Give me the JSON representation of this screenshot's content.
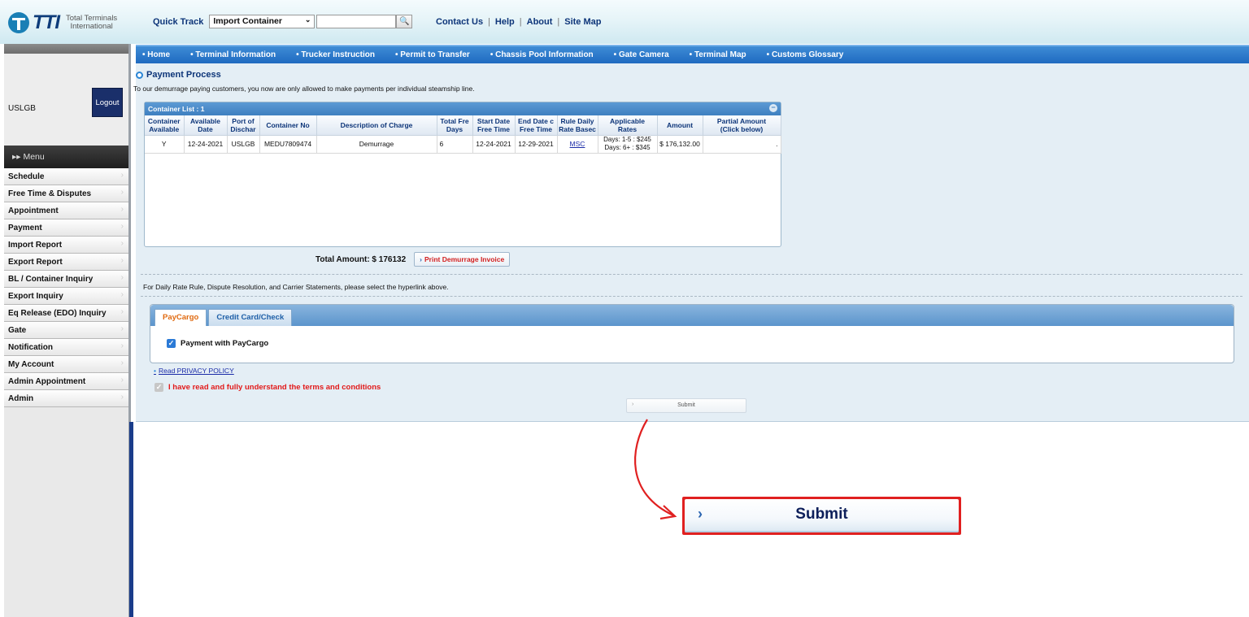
{
  "header": {
    "logo_text": "TTI",
    "logo_sub_line1": "Total Terminals",
    "logo_sub_line2": "International",
    "quick_track_label": "Quick Track",
    "quick_track_select": "Import Container",
    "quick_track_input": "",
    "top_links": [
      "Contact Us",
      "Help",
      "About",
      "Site Map"
    ]
  },
  "sidebar": {
    "user": "USLGB",
    "logout_label": "Logout",
    "menu_label": "▸▸ Menu",
    "items": [
      "Schedule",
      "Free Time & Disputes",
      "Appointment",
      "Payment",
      "Import Report",
      "Export Report",
      "BL / Container Inquiry",
      "Export Inquiry",
      "Eq Release (EDO) Inquiry",
      "Gate",
      "Notification",
      "My Account",
      "Admin Appointment",
      "Admin"
    ]
  },
  "nav": [
    "Home",
    "Terminal Information",
    "Trucker Instruction",
    "Permit to Transfer",
    "Chassis Pool Information",
    "Gate Camera",
    "Terminal Map",
    "Customs Glossary"
  ],
  "main": {
    "title": "Payment Process",
    "note": "To our demurrage paying customers, you now are only allowed to make payments per individual steamship line.",
    "container_list": {
      "header": "Container List : 1",
      "columns": [
        [
          "Container",
          "Available"
        ],
        [
          "Available",
          "Date"
        ],
        [
          "Port of",
          "Dischar"
        ],
        [
          "Container No",
          ""
        ],
        [
          "Description of Charge",
          ""
        ],
        [
          "Total Fre",
          "Days"
        ],
        [
          "Start Date",
          "Free Time"
        ],
        [
          "End Date c",
          "Free Time"
        ],
        [
          "Rule Daily",
          "Rate Basec"
        ],
        [
          "Applicable",
          "Rates"
        ],
        [
          "Amount",
          ""
        ],
        [
          "Partial Amount",
          "(Click below)"
        ]
      ],
      "row": {
        "available": "Y",
        "available_date": "12-24-2021",
        "port": "USLGB",
        "container_no": "MEDU7809474",
        "description": "Demurrage",
        "free_days": "6",
        "start_date": "12-24-2021",
        "end_date": "12-29-2021",
        "rule": "MSC",
        "rates_line1": "Days: 1-5 : $245",
        "rates_line2": "Days: 6+ : $345",
        "amount": "$ 176,132.00",
        "partial": "."
      }
    },
    "total_label": "Total Amount: $ 176132",
    "print_button": "Print Demurrage Invoice",
    "info_note": "For Daily Rate Rule, Dispute Resolution, and Carrier Statements, please select the hyperlink above.",
    "tabs": [
      "PayCargo",
      "Credit Card/Check"
    ],
    "paycargo_check_label": "Payment with PayCargo",
    "privacy_link": "Read PRIVACY POLICY",
    "terms_label": "I have read and fully understand the terms and conditions",
    "small_submit_label": "Submit"
  },
  "callout": {
    "submit_label": "Submit",
    "accent_color": "#e02020"
  }
}
